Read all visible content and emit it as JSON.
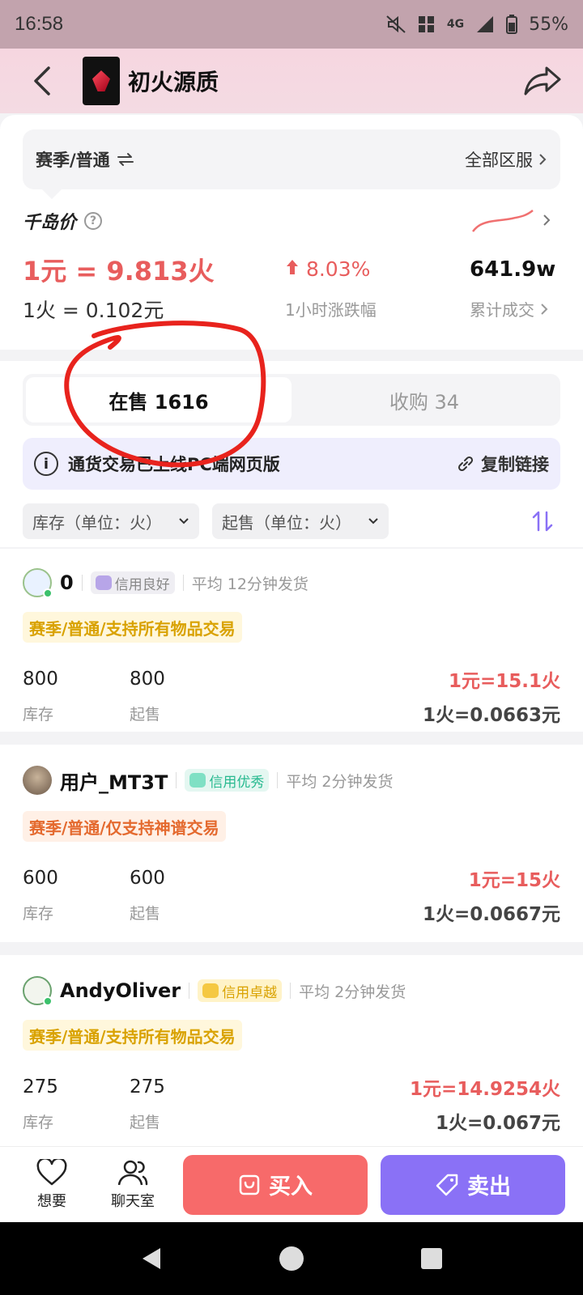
{
  "status": {
    "time": "16:58",
    "network": "4G",
    "battery": "55%"
  },
  "header": {
    "title": "初火源质",
    "back_icon": "back-arrow-icon",
    "share_icon": "share-icon"
  },
  "market": {
    "server_left": "赛季/普通",
    "server_right": "全部区服",
    "price_title": "千岛价",
    "rate_main": "1元 = 9.813火",
    "rate_sub": "1火 = 0.102元",
    "change_value": "8.03%",
    "change_label": "1小时涨跌幅",
    "volume_value": "641.9w",
    "volume_label": "累计成交"
  },
  "tabs": [
    {
      "label": "在售 1616",
      "active": true
    },
    {
      "label": "收购 34",
      "active": false
    }
  ],
  "notice": {
    "text": "通货交易已上线PC端网页版",
    "link": "复制链接"
  },
  "filters": {
    "stock": "库存（单位：火）",
    "min": "起售（单位：火）"
  },
  "listings": [
    {
      "seller": "0",
      "badge": "信用良好",
      "ship": "平均 12分钟发货",
      "tag": "赛季/普通/支持所有物品交易",
      "stock": "800",
      "stock_label": "库存",
      "min": "800",
      "min_label": "起售",
      "price_a": "1元=15.1火",
      "price_b": "1火=0.0663元"
    },
    {
      "seller": "用户_MT3T",
      "badge": "信用优秀",
      "ship": "平均 2分钟发货",
      "tag": "赛季/普通/仅支持神谱交易",
      "stock": "600",
      "stock_label": "库存",
      "min": "600",
      "min_label": "起售",
      "price_a": "1元=15火",
      "price_b": "1火=0.0667元"
    },
    {
      "seller": "AndyOliver",
      "badge": "信用卓越",
      "ship": "平均 2分钟发货",
      "tag": "赛季/普通/支持所有物品交易",
      "stock": "275",
      "stock_label": "库存",
      "min": "275",
      "min_label": "起售",
      "price_a": "1元=14.9254火",
      "price_b": "1火=0.067元"
    }
  ],
  "bottom": {
    "want": "想要",
    "chat": "聊天室",
    "buy": "买入",
    "sell": "卖出"
  },
  "colors": {
    "red": "#e85d5d",
    "purple": "#8a71f6",
    "buy": "#f76a6a"
  }
}
